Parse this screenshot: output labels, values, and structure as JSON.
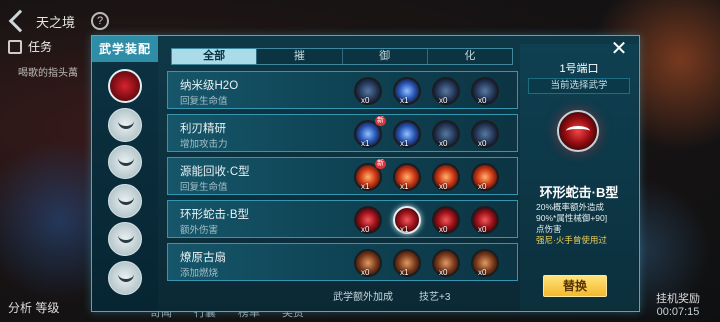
{
  "hud": {
    "scene_title": "天之境",
    "help_symbol": "?",
    "task_label": "任务",
    "task_sub": "喝歌的指头萬",
    "bottom_left": "分析",
    "bottom_nav": [
      "奇闻",
      "行囊",
      "榜单",
      "奖赏"
    ],
    "right_label": "挂机奖励",
    "right_timer": "00:07:15",
    "bottom_left_extra": "等级"
  },
  "panel": {
    "title": "武学装配",
    "tabs": [
      "全部",
      "摧",
      "御",
      "化"
    ],
    "active_tab": 0,
    "rows": [
      {
        "name": "纳米级H2O",
        "desc": "回复生命值",
        "gems": [
          {
            "cls": "g-dark",
            "count": "x0",
            "new": ""
          },
          {
            "cls": "g-blue",
            "count": "x1",
            "new": ""
          },
          {
            "cls": "g-dark",
            "count": "x0",
            "new": ""
          },
          {
            "cls": "g-dark",
            "count": "x0",
            "new": ""
          }
        ]
      },
      {
        "name": "利刃精研",
        "desc": "增加攻击力",
        "gems": [
          {
            "cls": "g-blue",
            "count": "x1",
            "new": "新"
          },
          {
            "cls": "g-blue",
            "count": "x1",
            "new": ""
          },
          {
            "cls": "g-dark",
            "count": "x0",
            "new": ""
          },
          {
            "cls": "g-dark",
            "count": "x0",
            "new": ""
          }
        ]
      },
      {
        "name": "源能回收·C型",
        "desc": "回复生命值",
        "gems": [
          {
            "cls": "g-fire",
            "count": "x1",
            "new": "新"
          },
          {
            "cls": "g-fire",
            "count": "x1",
            "new": ""
          },
          {
            "cls": "g-fire",
            "count": "x0",
            "new": ""
          },
          {
            "cls": "g-fire",
            "count": "x0",
            "new": ""
          }
        ]
      },
      {
        "name": "环形蛇击·B型",
        "desc": "额外伤害",
        "gems": [
          {
            "cls": "g-red",
            "count": "x0",
            "new": ""
          },
          {
            "cls": "g-red",
            "count": "x1",
            "new": "",
            "sel": true
          },
          {
            "cls": "g-red",
            "count": "x0",
            "new": ""
          },
          {
            "cls": "g-red",
            "count": "x0",
            "new": ""
          }
        ]
      },
      {
        "name": "燎原古扇",
        "desc": "添加燃烧",
        "gems": [
          {
            "cls": "g-bronze",
            "count": "x0",
            "new": ""
          },
          {
            "cls": "g-bronze",
            "count": "x1",
            "new": ""
          },
          {
            "cls": "g-bronze",
            "count": "x0",
            "new": ""
          },
          {
            "cls": "g-bronze",
            "count": "x0",
            "new": ""
          }
        ]
      }
    ],
    "footer_label": "武学额外加成",
    "footer_value": "技艺+3"
  },
  "info": {
    "port": "1号端口",
    "current_label": "当前选择武学",
    "skill_name": "环形蛇击·B型",
    "desc_line1": "20%概率额外造成",
    "desc_line2": "90%*属性械御+90]",
    "desc_line3": "点伤害",
    "desc_note": "强尼·火手曾使用过",
    "button": "替换"
  }
}
